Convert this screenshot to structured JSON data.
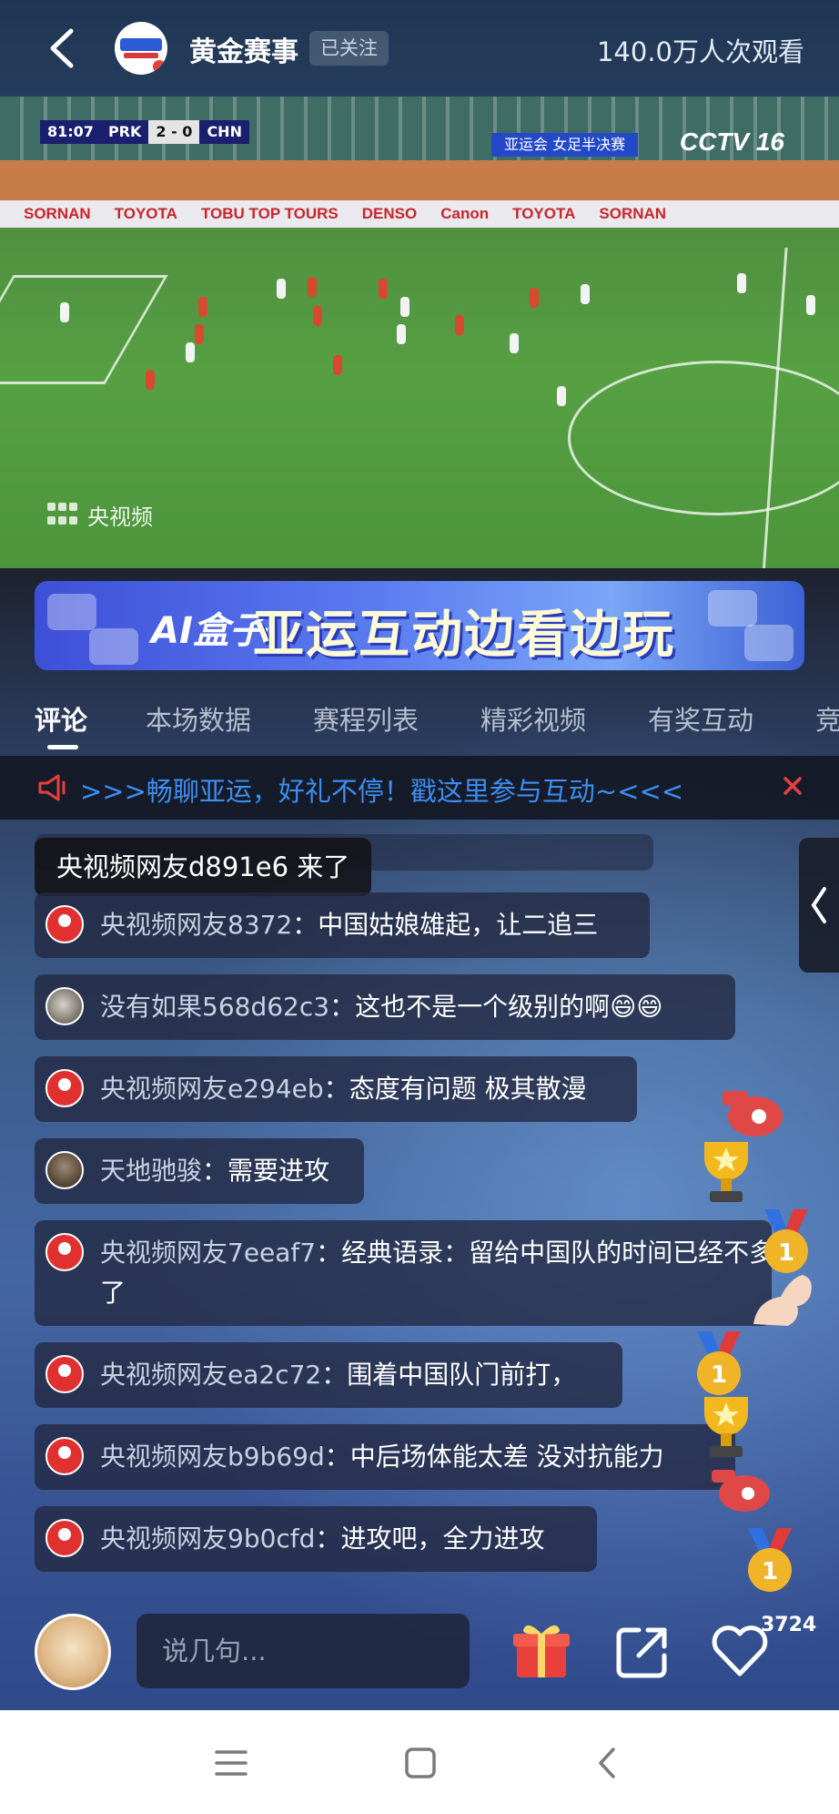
{
  "header": {
    "channel_name": "黄金赛事",
    "follow_status": "已关注",
    "viewer_count": "140.0万人次观看"
  },
  "video": {
    "scorebug": {
      "clock": "81:07",
      "team_home": "PRK",
      "score": "2 - 0",
      "team_away": "CHN"
    },
    "event_tag": "亚运会 女足半决赛",
    "broadcaster": "CCTV 16",
    "ads": [
      "SORNAN",
      "TOYOTA",
      "TOBU TOP TOURS",
      "DENSO",
      "Canon",
      "TOYOTA",
      "SORNAN"
    ],
    "watermark": "央视频"
  },
  "banner": {
    "ai_label": "AI盒子",
    "title": "亚运互动边看边玩"
  },
  "tabs": [
    {
      "label": "评论",
      "active": true
    },
    {
      "label": "本场数据",
      "active": false
    },
    {
      "label": "赛程列表",
      "active": false
    },
    {
      "label": "精彩视频",
      "active": false
    },
    {
      "label": "有奖互动",
      "active": false
    },
    {
      "label": "竞",
      "active": false
    }
  ],
  "notice": {
    "text": ">>>畅聊亚运，好礼不停！戳这里参与互动~<<<"
  },
  "join_message": "央视频网友d891e6 来了",
  "comments": [
    {
      "user": "央视频网友8372",
      "text": "中国姑娘雄起，让二追三",
      "avatar": "default"
    },
    {
      "user": "没有如果568d62c3",
      "text": "这也不是一个级别的啊😄😄",
      "avatar": "photo"
    },
    {
      "user": "央视频网友e294eb",
      "text": "态度有问题 极其散漫",
      "avatar": "default"
    },
    {
      "user": "天地驰骏",
      "text": "需要进攻",
      "avatar": "photo2"
    },
    {
      "user": "央视频网友7eeaf7",
      "text": "经典语录：留给中国队的时间已经不多了",
      "avatar": "default"
    },
    {
      "user": "央视频网友ea2c72",
      "text": "围着中国队门前打，",
      "avatar": "default"
    },
    {
      "user": "央视频网友b9b69d",
      "text": "中后场体能太差 没对抗能力",
      "avatar": "default"
    },
    {
      "user": "央视频网友9b0cfd",
      "text": "进攻吧，全力进攻",
      "avatar": "default"
    }
  ],
  "input": {
    "placeholder": "说几句..."
  },
  "like_count": "3724",
  "colors": {
    "notice_text": "#3d8ef0",
    "close_red": "#e8413c",
    "accent_yellow": "#fffbd8"
  }
}
